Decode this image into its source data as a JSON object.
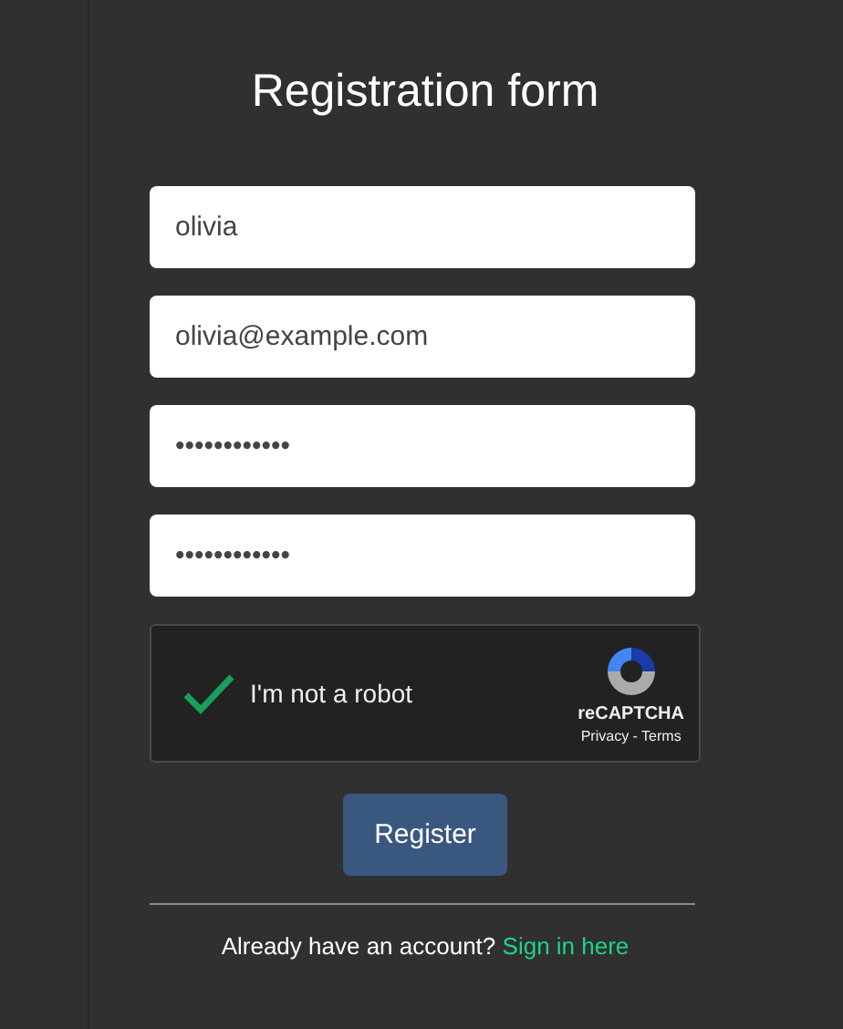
{
  "title": "Registration form",
  "fields": [
    {
      "value": "olivia"
    },
    {
      "value": "olivia@example.com"
    },
    {
      "value": "••••••••••••"
    },
    {
      "value": "••••••••••••"
    }
  ],
  "captcha": {
    "checked": true,
    "label": "I'm not a robot",
    "brand": "reCAPTCHA",
    "links": "Privacy - Terms"
  },
  "submit": "Register",
  "footer": {
    "text": "Already have an account?",
    "link": "Sign in here"
  }
}
